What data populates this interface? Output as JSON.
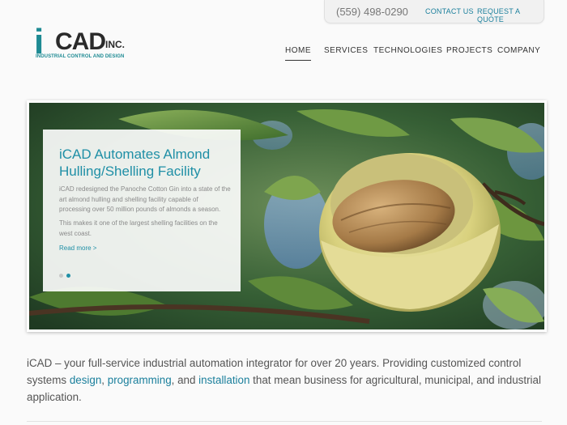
{
  "utility": {
    "phone": "(559) 498-0290",
    "contact": "CONTACT US",
    "quote": "REQUEST A QUOTE"
  },
  "logo": {
    "i": "i",
    "cad": "CAD",
    "inc": "INC.",
    "tagline": "INDUSTRIAL CONTROL AND DESIGN"
  },
  "nav": {
    "home": "HOME",
    "services": "SERVICES",
    "technologies": "TECHNOLOGIES",
    "projects": "PROJECTS",
    "company": "COMPANY"
  },
  "hero": {
    "title": "iCAD Automates Almond Hulling/Shelling Facility",
    "p1": "iCAD redesigned the Panoche Cotton Gin into a state of the art almond hulling and shelling facility capable of processing over 50 million pounds of almonds a season.",
    "p2": "This makes it one of the largest shelling facilities on the west coast.",
    "read_more": "Read more >",
    "active_slide": 2,
    "slide_count": 2
  },
  "intro": {
    "text_1": "iCAD – your full-service industrial automation integrator for over 20 years. Providing customized control systems ",
    "link_design": "design",
    "sep_1": ", ",
    "link_programming": "programming",
    "sep_2": ", and ",
    "link_installation": "installation",
    "text_2": " that mean business for agricultural, municipal, and industrial application."
  },
  "colors": {
    "accent": "#1f8fa6",
    "logo_teal": "#1d8a93",
    "text": "#555555"
  }
}
